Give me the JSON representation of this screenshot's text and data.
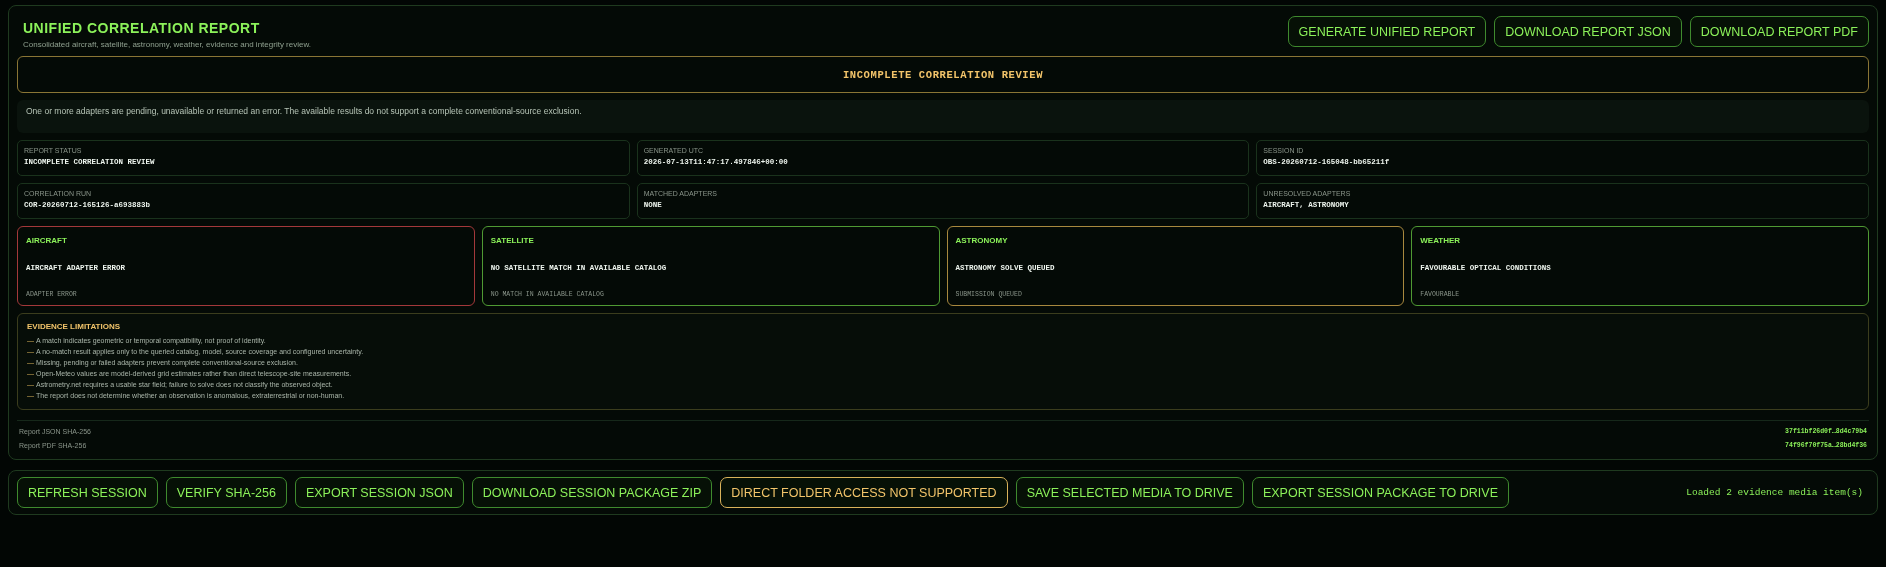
{
  "report": {
    "title": "UNIFIED CORRELATION REPORT",
    "subtitle": "Consolidated aircraft, satellite, astronomy, weather, evidence and integrity review.",
    "actions": [
      "GENERATE UNIFIED REPORT",
      "DOWNLOAD REPORT JSON",
      "DOWNLOAD REPORT PDF"
    ],
    "banner": "INCOMPLETE CORRELATION REVIEW",
    "message": "One or more adapters are pending, unavailable or returned an error. The available results do not support a complete conventional-source exclusion.",
    "fields": [
      {
        "label": "REPORT STATUS",
        "value": "INCOMPLETE CORRELATION REVIEW"
      },
      {
        "label": "GENERATED UTC",
        "value": "2026-07-13T11:47:17.497846+00:00"
      },
      {
        "label": "SESSION ID",
        "value": "OBS-20260712-165048-bb65211f"
      },
      {
        "label": "CORRELATION RUN",
        "value": "COR-20260712-165126-a693883b"
      },
      {
        "label": "MATCHED ADAPTERS",
        "value": "NONE"
      },
      {
        "label": "UNRESOLVED ADAPTERS",
        "value": "AIRCRAFT, ASTRONOMY"
      }
    ],
    "adapters": [
      {
        "title": "AIRCRAFT",
        "result": "AIRCRAFT ADAPTER ERROR",
        "status_text": "ADAPTER ERROR",
        "kind": "error"
      },
      {
        "title": "SATELLITE",
        "result": "NO SATELLITE MATCH IN AVAILABLE CATALOG",
        "status_text": "NO MATCH IN AVAILABLE CATALOG",
        "kind": "ok"
      },
      {
        "title": "ASTRONOMY",
        "result": "ASTRONOMY SOLVE QUEUED",
        "status_text": "SUBMISSION QUEUED",
        "kind": "pending"
      },
      {
        "title": "WEATHER",
        "result": "FAVOURABLE OPTICAL CONDITIONS",
        "status_text": "FAVOURABLE",
        "kind": "ok"
      }
    ],
    "limitations": {
      "title": "EVIDENCE LIMITATIONS",
      "bullet": "—",
      "items": [
        "A match indicates geometric or temporal compatibility, not proof of identity.",
        "A no-match result applies only to the queried catalog, model, source coverage and configured uncertainty.",
        "Missing, pending or failed adapters prevent complete conventional-source exclusion.",
        "Open-Meteo values are model-derived grid estimates rather than direct telescope-site measurements.",
        "Astrometry.net requires a usable star field; failure to solve does not classify the observed object.",
        "The report does not determine whether an observation is anomalous, extraterrestrial or non-human."
      ]
    },
    "hashes": [
      {
        "label": "Report JSON SHA-256",
        "value": "37f11bf26d0f…8d4c79b4"
      },
      {
        "label": "Report PDF SHA-256",
        "value": "74f96f70f75a…28bd4f36"
      }
    ]
  },
  "toolbar": {
    "buttons": [
      {
        "label": "REFRESH SESSION",
        "kind": "action"
      },
      {
        "label": "VERIFY SHA-256",
        "kind": "action"
      },
      {
        "label": "EXPORT SESSION JSON",
        "kind": "action"
      },
      {
        "label": "DOWNLOAD SESSION PACKAGE ZIP",
        "kind": "action"
      },
      {
        "label": "DIRECT FOLDER ACCESS NOT SUPPORTED",
        "kind": "warning"
      },
      {
        "label": "SAVE SELECTED MEDIA TO DRIVE",
        "kind": "action"
      },
      {
        "label": "EXPORT SESSION PACKAGE TO DRIVE",
        "kind": "action"
      }
    ],
    "status": "Loaded 2 evidence media item(s)"
  }
}
